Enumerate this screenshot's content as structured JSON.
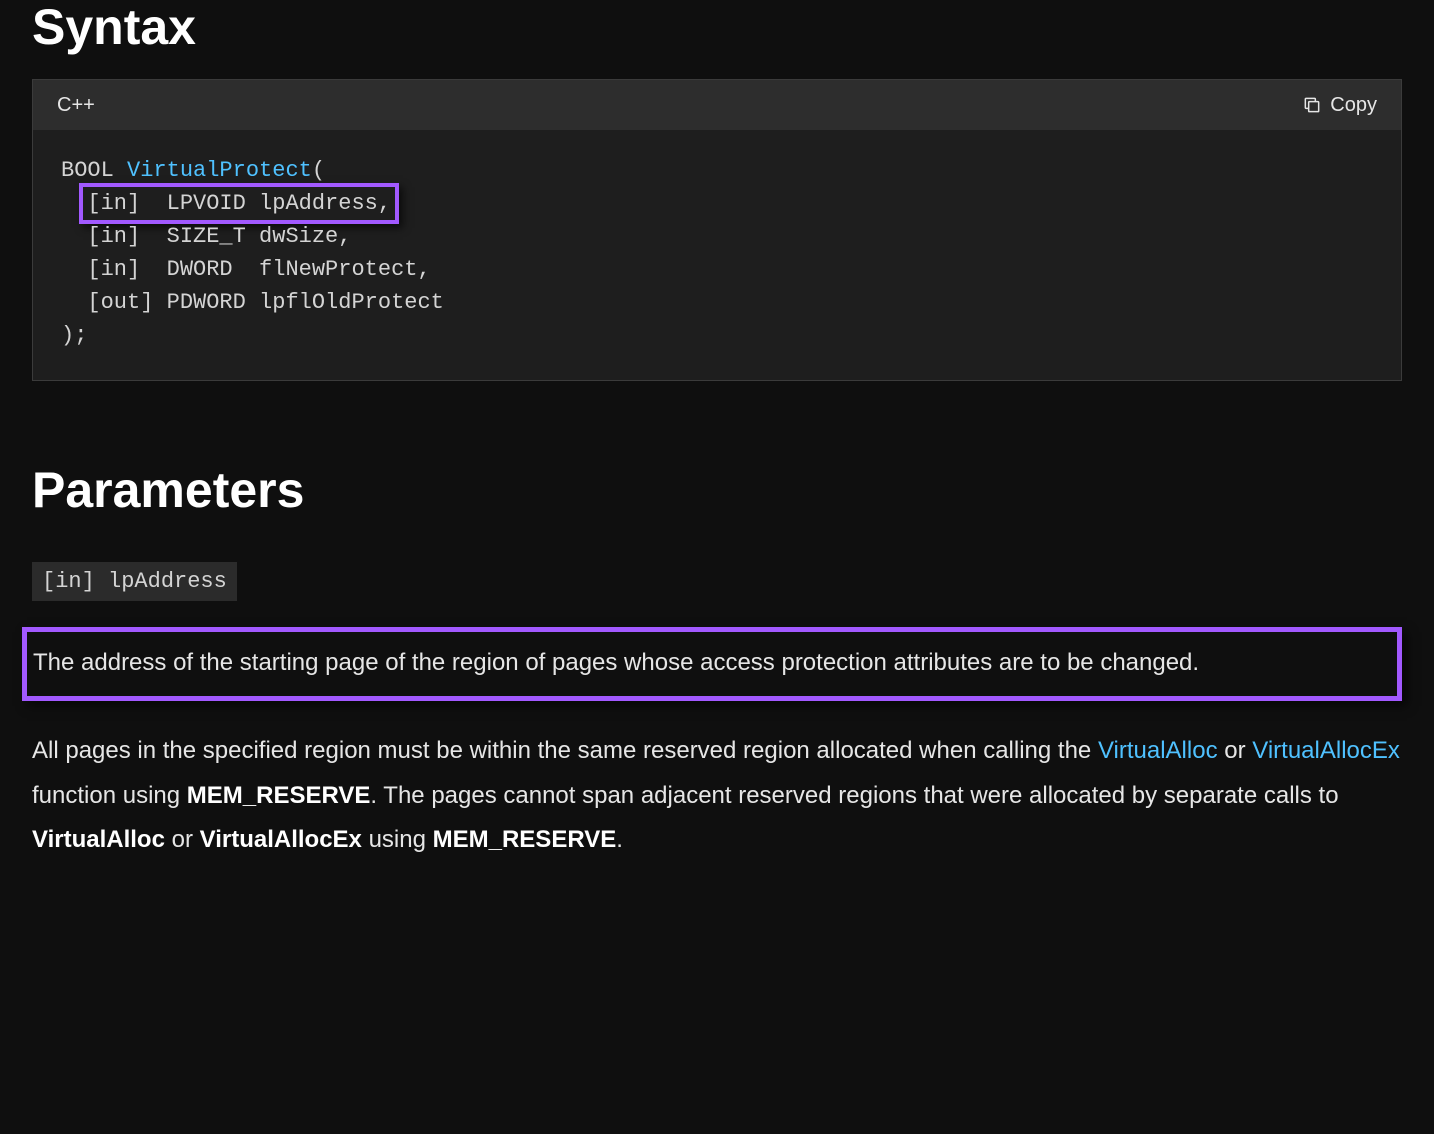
{
  "syntax": {
    "heading": "Syntax",
    "language_label": "C++",
    "copy_label": "Copy",
    "code": {
      "return_type": "BOOL",
      "function_name": "VirtualProtect",
      "open": "(",
      "params": [
        {
          "dir": "[in]",
          "type": "LPVOID",
          "name": "lpAddress,"
        },
        {
          "dir": "[in]",
          "type": "SIZE_T",
          "name": "dwSize,"
        },
        {
          "dir": "[in]",
          "type": "DWORD",
          "name": "flNewProtect,"
        },
        {
          "dir": "[out]",
          "type": "PDWORD",
          "name": "lpflOldProtect"
        }
      ],
      "close": ");"
    }
  },
  "parameters": {
    "heading": "Parameters",
    "param_label": "[in] lpAddress",
    "description_highlighted": "The address of the starting page of the region of pages whose access protection attributes are to be changed.",
    "para2": {
      "t1": "All pages in the specified region must be within the same reserved region allocated when calling the ",
      "link1": "VirtualAlloc",
      "t2": " or ",
      "link2": "VirtualAllocEx",
      "t3": " function using ",
      "b1": "MEM_RESERVE",
      "t4": ". The pages cannot span adjacent reserved regions that were allocated by separate calls to ",
      "b2": "VirtualAlloc",
      "t5": " or ",
      "b3": "VirtualAllocEx",
      "t6": " using ",
      "b4": "MEM_RESERVE",
      "t7": "."
    }
  },
  "highlight_color": "#a259ff"
}
